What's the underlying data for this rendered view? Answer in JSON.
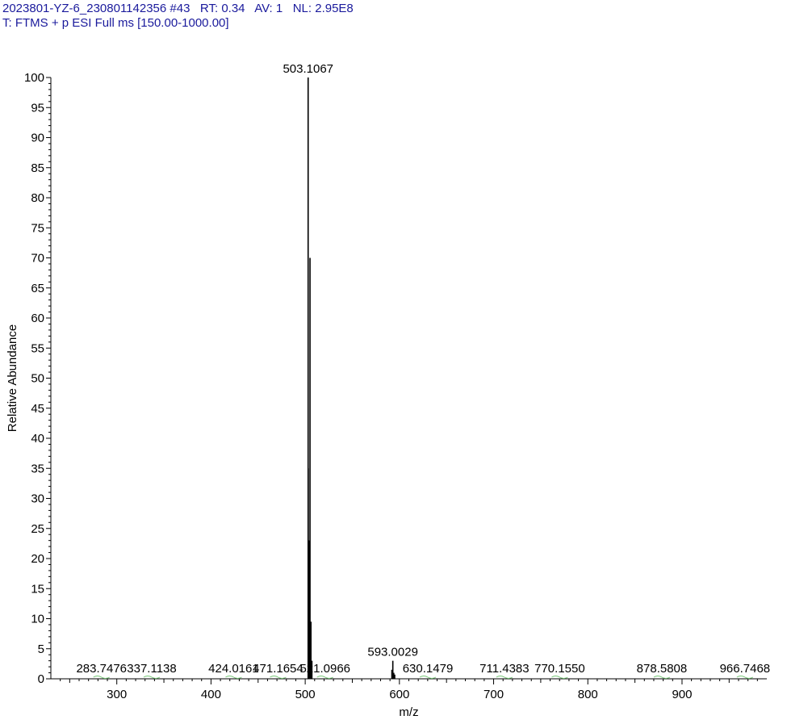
{
  "header": {
    "line1": "2023801-YZ-6_230801142356 #43   RT: 0.34   AV: 1   NL: 2.95E8",
    "line2": "T: FTMS + p ESI Full ms [150.00-1000.00]"
  },
  "chart_data": {
    "type": "bar",
    "xlabel": "m/z",
    "ylabel": "Relative Abundance",
    "xlim": [
      230,
      990
    ],
    "ylim": [
      0,
      100
    ],
    "x_ticks": [
      300,
      400,
      500,
      600,
      700,
      800,
      900
    ],
    "y_ticks": [
      0,
      5,
      10,
      15,
      20,
      25,
      30,
      35,
      40,
      45,
      50,
      55,
      60,
      65,
      70,
      75,
      80,
      85,
      90,
      95,
      100
    ],
    "peaks": [
      {
        "x": 503.1067,
        "y": 100
      },
      {
        "x": 503.2,
        "y": 35
      },
      {
        "x": 504.11,
        "y": 23
      },
      {
        "x": 505.1,
        "y": 70
      },
      {
        "x": 506.1,
        "y": 9.5
      },
      {
        "x": 507.1,
        "y": 3
      },
      {
        "x": 592.0,
        "y": 1.5
      },
      {
        "x": 593.0029,
        "y": 3
      },
      {
        "x": 594.0,
        "y": 1
      },
      {
        "x": 595.0,
        "y": 0.7
      }
    ],
    "peak_labels": [
      {
        "x": 503.1067,
        "y": 100,
        "text": "503.1067"
      },
      {
        "x": 593.0029,
        "y": 3,
        "text": "593.0029"
      },
      {
        "x": 283.7476,
        "y": 0.3,
        "text": "283.7476"
      },
      {
        "x": 337.1138,
        "y": 0.3,
        "text": "337.1138"
      },
      {
        "x": 424.0161,
        "y": 0.3,
        "text": "424.0161"
      },
      {
        "x": 471.1654,
        "y": 0.3,
        "text": "471.1654"
      },
      {
        "x": 521.0966,
        "y": 0.3,
        "text": "521.0966"
      },
      {
        "x": 630.1479,
        "y": 0.3,
        "text": "630.1479"
      },
      {
        "x": 711.4383,
        "y": 0.3,
        "text": "711.4383"
      },
      {
        "x": 770.155,
        "y": 0.3,
        "text": "770.1550"
      },
      {
        "x": 878.5808,
        "y": 0.3,
        "text": "878.5808"
      },
      {
        "x": 966.7468,
        "y": 0.3,
        "text": "966.7468"
      }
    ]
  }
}
